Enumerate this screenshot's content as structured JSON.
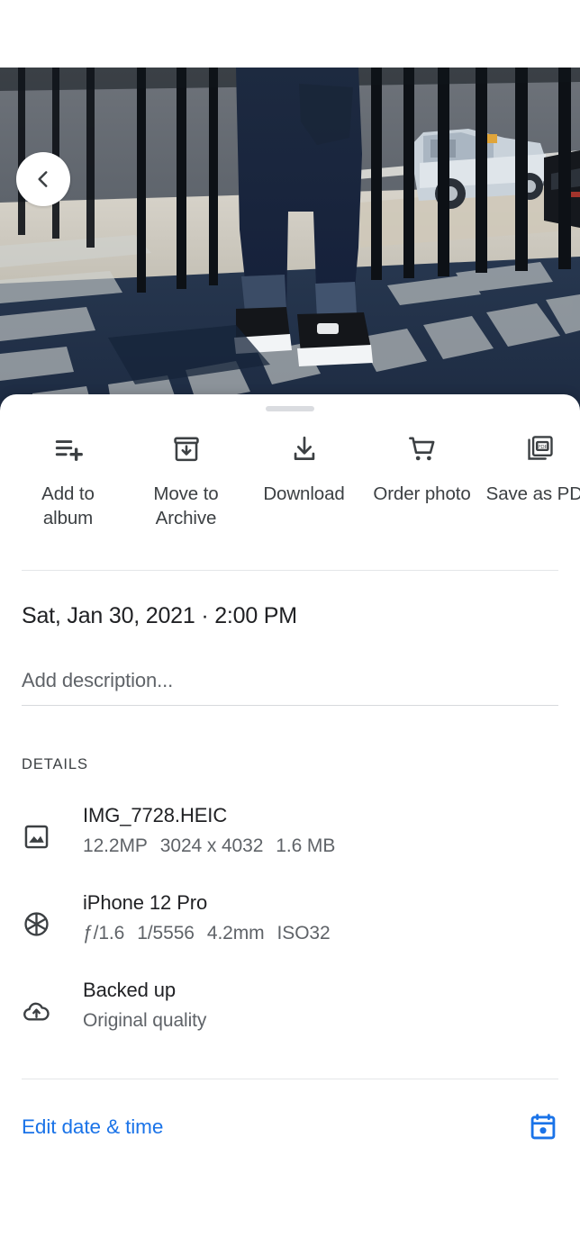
{
  "photo": {
    "alt_description": "Child in dark blue jeans and black-and-white sneakers standing on sunlit concrete behind a black metal fence, long fence shadows across the ground, white pickup truck and dark car in parking lot beyond",
    "back_icon": "chevron-left-icon"
  },
  "sheet": {
    "drag_handle": "drag-handle"
  },
  "actions": [
    {
      "id": "add-to-album",
      "icon": "playlist-add-icon",
      "label": "Add to\nalbum"
    },
    {
      "id": "move-to-archive",
      "icon": "archive-icon",
      "label": "Move to\nArchive"
    },
    {
      "id": "download",
      "icon": "download-icon",
      "label": "Download"
    },
    {
      "id": "order-photo",
      "icon": "shopping-cart-icon",
      "label": "Order photo"
    },
    {
      "id": "save-as-pdf",
      "icon": "pdf-icon",
      "label": "Save as PDF"
    }
  ],
  "date": {
    "text": "Sat, Jan 30, 2021  ·  2:00 PM"
  },
  "description": {
    "placeholder": "Add description...",
    "value": ""
  },
  "details": {
    "header": "DETAILS",
    "rows": [
      {
        "id": "file-info",
        "icon": "image-icon",
        "primary": "IMG_7728.HEIC",
        "secondary": [
          "12.2MP",
          "3024 x 4032",
          "1.6 MB"
        ]
      },
      {
        "id": "camera-info",
        "icon": "aperture-icon",
        "primary": "iPhone 12 Pro",
        "secondary": [
          "ƒ/1.6",
          "1/5556",
          "4.2mm",
          "ISO32"
        ]
      },
      {
        "id": "backup-info",
        "icon": "cloud-upload-icon",
        "primary": "Backed up",
        "secondary": [
          "Original quality"
        ]
      }
    ]
  },
  "edit_date": {
    "label": "Edit date & time",
    "icon": "calendar-icon"
  },
  "colors": {
    "accent_blue": "#1a73e8",
    "icon_gray": "#3c4043",
    "text_primary": "#202124",
    "text_secondary": "#5f6368",
    "divider": "#e4e6e8",
    "sheet_bg": "#ffffff"
  }
}
